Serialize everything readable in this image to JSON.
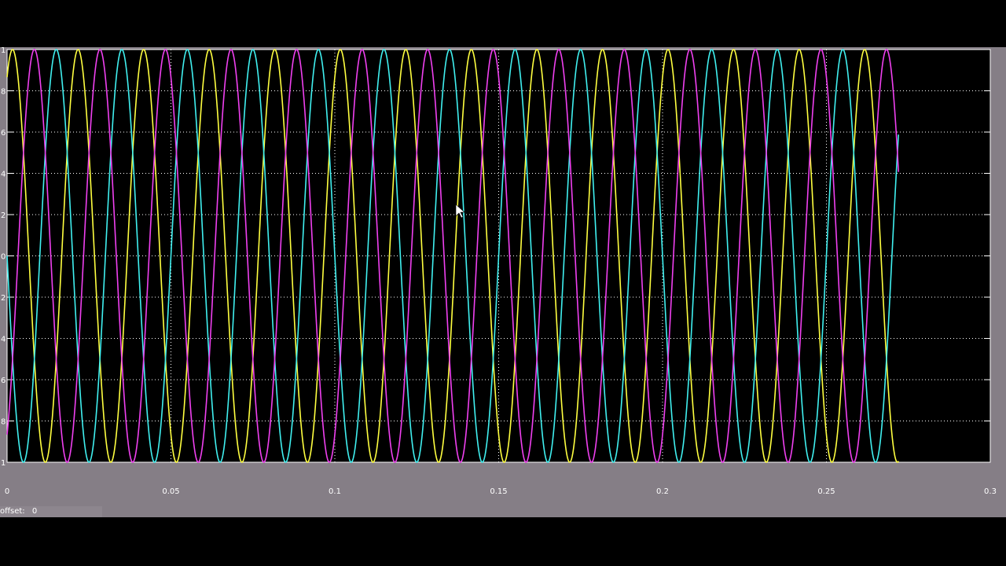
{
  "chart_data": {
    "type": "line",
    "xlim": [
      0,
      0.3
    ],
    "ylim": [
      -1,
      1
    ],
    "grid": true,
    "x_ticks": [
      0,
      0.05,
      0.1,
      0.15,
      0.2,
      0.25,
      0.3
    ],
    "x_tick_labels": [
      "0",
      "0.05",
      "0.1",
      "0.15",
      "0.2",
      "0.25",
      "0.3"
    ],
    "y_ticks": [
      1,
      0.8,
      0.6,
      0.4,
      0.2,
      0,
      -0.2,
      -0.4,
      -0.6,
      -0.8,
      -1
    ],
    "y_tick_labels_visible": [
      "1",
      "8",
      "6",
      "4",
      "2",
      "0",
      "2",
      "4",
      "6",
      "8",
      "1"
    ],
    "t_end": 0.272,
    "series": [
      {
        "function": "sine",
        "amplitude": 1,
        "frequency_hz": 50,
        "phase_deg": 60,
        "color": "#ffff40"
      },
      {
        "function": "sine",
        "amplitude": 1,
        "frequency_hz": 50,
        "phase_deg": 180,
        "color": "#40f0f0"
      },
      {
        "function": "sine",
        "amplitude": 1,
        "frequency_hz": 50,
        "phase_deg": -60,
        "color": "#f040f0"
      }
    ]
  },
  "footer": {
    "offset_label": "offset:",
    "offset_value": "0"
  },
  "colors": {
    "background": "#000000",
    "frame": "#857e86",
    "grid": "#ffffff"
  }
}
